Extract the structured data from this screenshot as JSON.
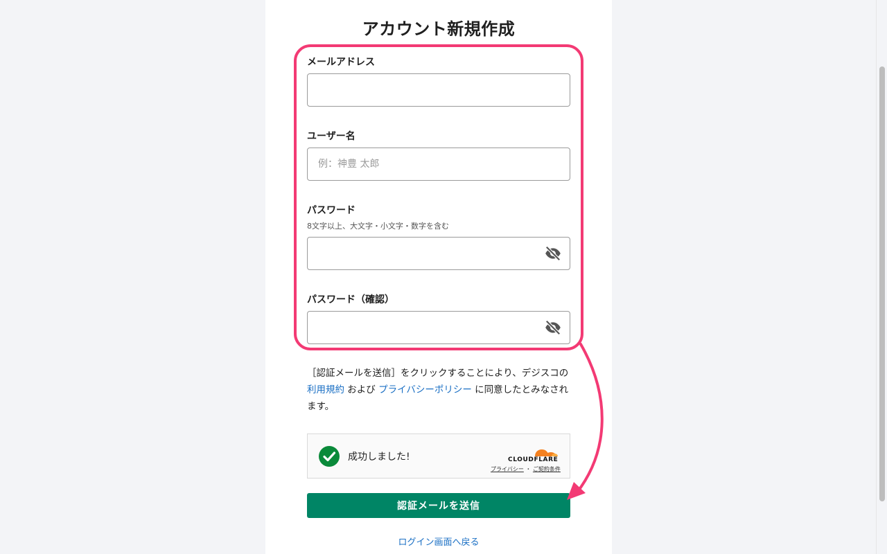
{
  "page": {
    "title": "アカウント新規作成"
  },
  "form": {
    "email": {
      "label": "メールアドレス",
      "value": "",
      "placeholder": ""
    },
    "username": {
      "label": "ユーザー名",
      "value": "",
      "placeholder": "例：神豊 太郎"
    },
    "password": {
      "label": "パスワード",
      "hint": "8文字以上、大文字・小文字・数字を含む",
      "value": "",
      "toggle_icon": "eye-slash-icon"
    },
    "password_confirm": {
      "label": "パスワード（確認）",
      "value": "",
      "toggle_icon": "eye-slash-icon"
    }
  },
  "terms": {
    "prefix": "［認証メールを送信］をクリックすることにより、デジスコの ",
    "terms_link": "利用規約",
    "middle": " および ",
    "privacy_link": "プライバシーポリシー",
    "suffix": " に同意したとみなされます。"
  },
  "captcha": {
    "status": "成功しました!",
    "brand": "CLOUDFLARE",
    "privacy_link": "プライバシー",
    "separator": "・",
    "terms_link": "ご契約条件",
    "check_color": "#0a8a3a",
    "brand_color": "#f48120"
  },
  "actions": {
    "submit_label": "認証メールを送信",
    "back_link": "ログイン画面へ戻る"
  },
  "colors": {
    "accent": "#008565",
    "link": "#1a6fc4",
    "annotation": "#f33a74"
  }
}
